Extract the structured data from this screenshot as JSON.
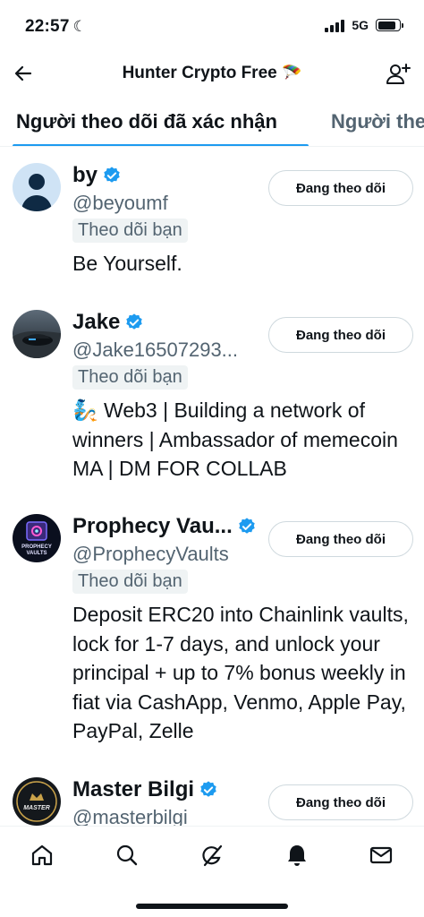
{
  "status_bar": {
    "time": "22:57",
    "network": "5G",
    "battery_level": 0.85
  },
  "header": {
    "title": "Hunter Crypto Free",
    "title_emoji": "🪂"
  },
  "tabs": [
    {
      "label": "Người theo dõi đã xác nhận",
      "active": true
    },
    {
      "label": "Người the",
      "active": false
    }
  ],
  "users": [
    {
      "name": "by",
      "handle": "@beyoumf",
      "follows_you": "Theo dõi bạn",
      "bio": "Be Yourself.",
      "button": "Đang theo dõi",
      "avatar": "default-avatar"
    },
    {
      "name": "Jake",
      "handle": "@Jake16507293...",
      "follows_you": "Theo dõi bạn",
      "bio": "🧞 Web3 | Building a network of winners | Ambassador of memecoin MA | DM FOR COLLAB",
      "button": "Đang theo dõi",
      "avatar": "car-photo-avatar"
    },
    {
      "name": "Prophecy Vau...",
      "handle": "@ProphecyVaults",
      "follows_you": "Theo dõi bạn",
      "bio": "Deposit ERC20 into Chainlink vaults, lock for 1-7 days, and unlock your principal + up to 7% bonus weekly in fiat via CashApp, Venmo, Apple Pay, PayPal, Zelle",
      "button": "Đang theo dõi",
      "avatar": "prophecy-vaults-logo",
      "avatar_text": "PROPHECY VAULTS"
    },
    {
      "name": "Master Bilgi",
      "handle": "@masterbilgi",
      "button": "Đang theo dõi",
      "avatar": "master-bilgi-logo",
      "avatar_text": "MASTER"
    }
  ],
  "nav": [
    "home-icon",
    "search-icon",
    "grok-icon",
    "notifications-bell-icon",
    "messages-mail-icon"
  ],
  "colors": {
    "accent": "#1d9bf0",
    "text": "#0f1419",
    "secondary": "#536471"
  }
}
